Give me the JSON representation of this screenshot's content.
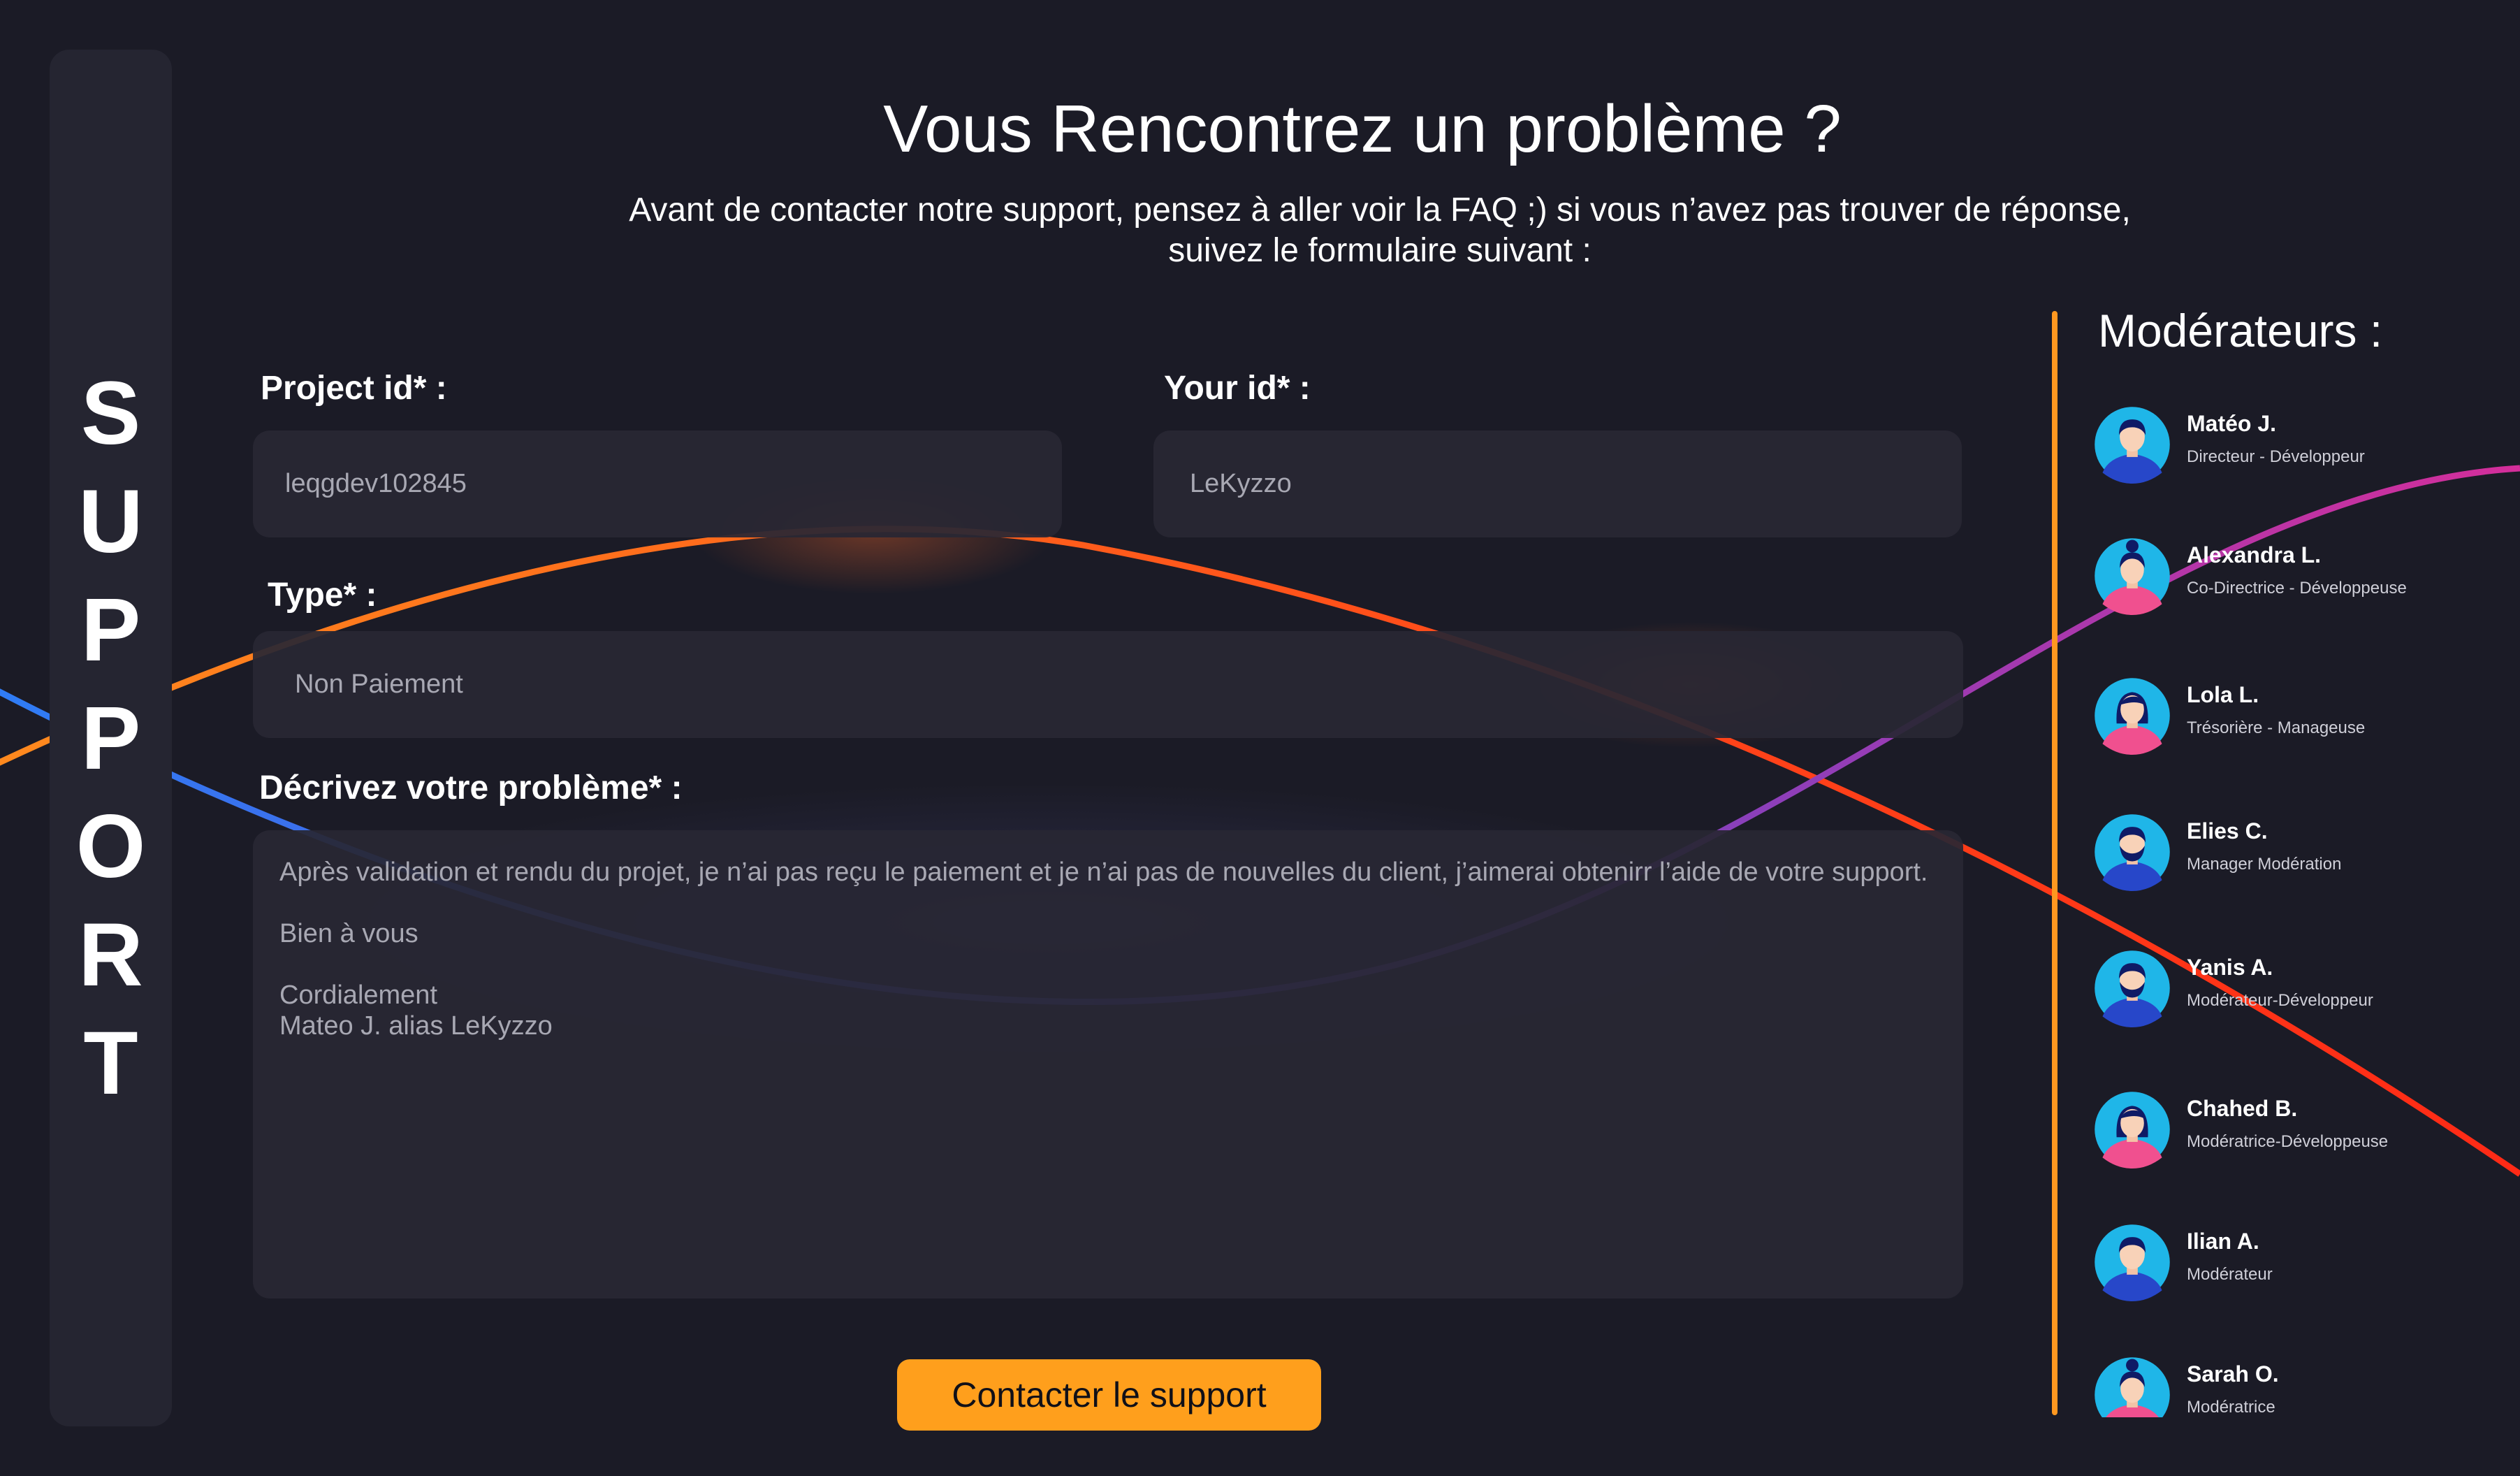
{
  "sidebar": {
    "letters": [
      "S",
      "U",
      "P",
      "P",
      "O",
      "R",
      "T"
    ]
  },
  "header": {
    "title": "Vous Rencontrez un problème ?",
    "subtitle": "Avant de contacter notre support, pensez à aller voir la FAQ ;) si vous n’avez pas trouver de réponse, suivez le formulaire suivant :"
  },
  "form": {
    "project_id": {
      "label": "Project id* :",
      "value": "leqgdev102845"
    },
    "your_id": {
      "label": "Your id* :",
      "value": "LeKyzzo"
    },
    "type": {
      "label": "Type* :",
      "value": "Non Paiement"
    },
    "description": {
      "label": "Décrivez votre problème* :",
      "value": "Après validation et rendu du projet, je n’ai pas reçu le paiement et je n’ai pas de nouvelles du client, j’aimerai obtenirr l’aide de votre support.\n\nBien à vous\n\nCordialement\nMateo J. alias LeKyzzo"
    },
    "submit_label": "Contacter le support"
  },
  "moderators": {
    "title": "Modérateurs :",
    "items": [
      {
        "name": "Matéo J.",
        "role": "Directeur - Développeur",
        "avatar": "male-avatar-icon"
      },
      {
        "name": "Alexandra L.",
        "role": "Co-Directrice - Développeuse",
        "avatar": "female-bun-avatar-icon"
      },
      {
        "name": "Lola L.",
        "role": "Trésorière - Manageuse",
        "avatar": "female-avatar-icon"
      },
      {
        "name": "Elies C.",
        "role": "Manager Modération",
        "avatar": "bearded-male-avatar-icon"
      },
      {
        "name": "Yanis A.",
        "role": "Modérateur-Développeur",
        "avatar": "bearded-male-avatar-icon"
      },
      {
        "name": "Chahed B.",
        "role": "Modératrice-Développeuse",
        "avatar": "female-avatar-icon"
      },
      {
        "name": "Ilian A.",
        "role": "Modérateur",
        "avatar": "male-avatar-icon"
      },
      {
        "name": "Sarah O.",
        "role": "Modératrice",
        "avatar": "female-bun-avatar-icon"
      }
    ]
  },
  "colors": {
    "background": "#1b1b26",
    "panel": "#252531",
    "accent": "#ff9f1c",
    "divider": "#ff9820"
  }
}
